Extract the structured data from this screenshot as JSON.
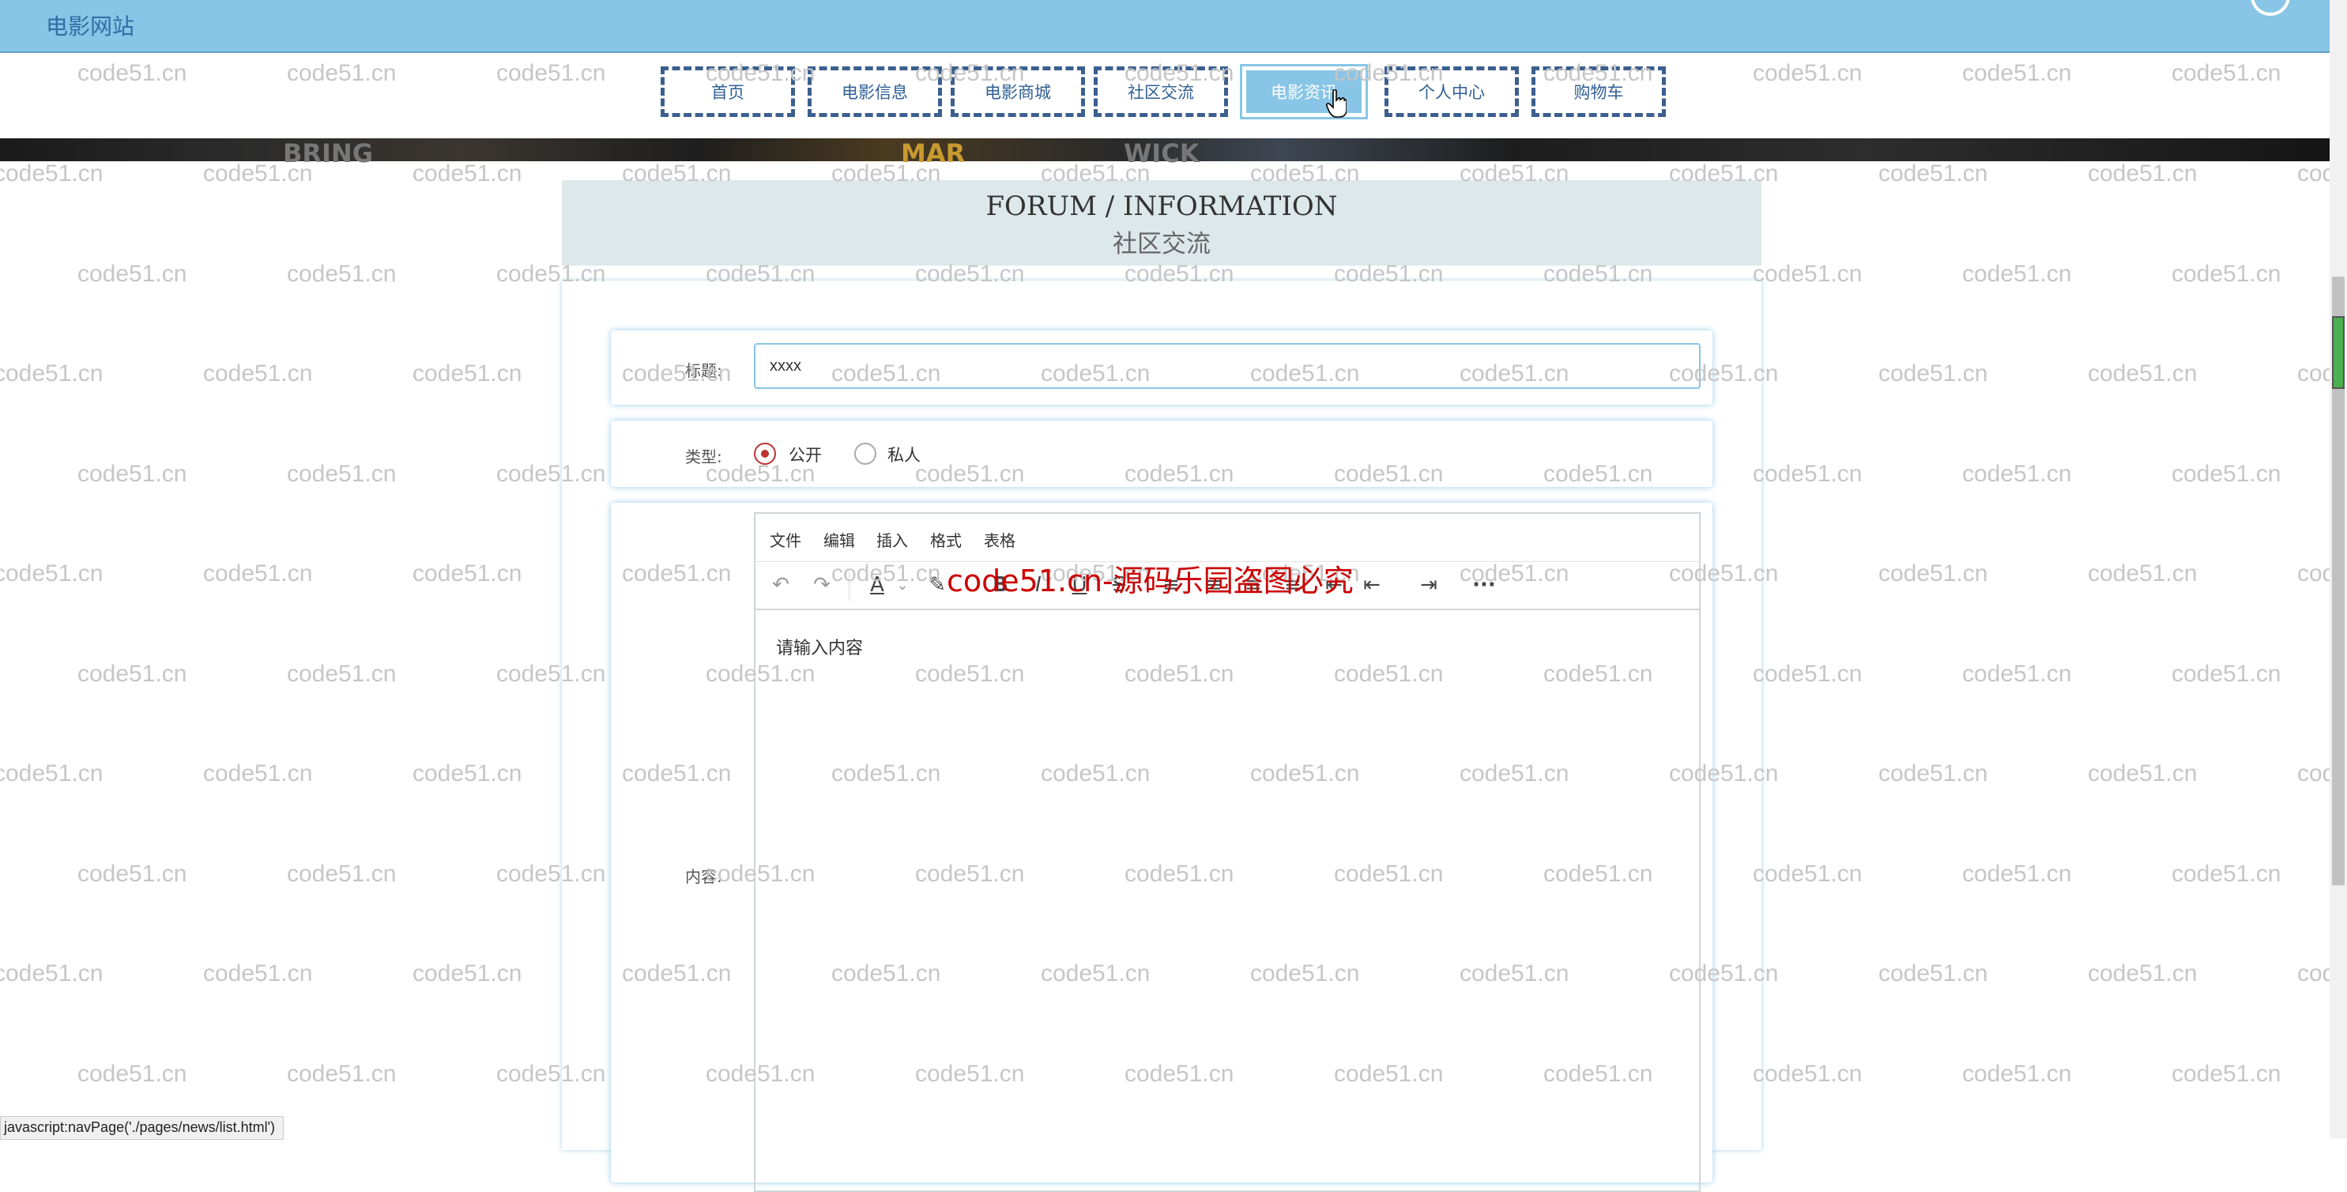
{
  "header": {
    "site_title": "电影网站"
  },
  "nav": {
    "items": [
      {
        "label": "首页"
      },
      {
        "label": "电影信息"
      },
      {
        "label": "电影商城"
      },
      {
        "label": "社区交流"
      },
      {
        "label": "电影资讯"
      },
      {
        "label": "个人中心"
      },
      {
        "label": "购物车"
      }
    ],
    "active_index": 4
  },
  "banner": {
    "fragments": [
      "BRING",
      "MAR",
      "WICK"
    ]
  },
  "section": {
    "title_en": "FORUM / INFORMATION",
    "title_cn": "社区交流"
  },
  "form": {
    "title_label": "标题:",
    "title_value": "xxxx",
    "type_label": "类型:",
    "type_options": [
      {
        "label": "公开",
        "checked": true
      },
      {
        "label": "私人",
        "checked": false
      }
    ],
    "content_label": "内容:"
  },
  "editor": {
    "menu": [
      "文件",
      "编辑",
      "插入",
      "格式",
      "表格"
    ],
    "toolbar_icons": [
      "undo-icon",
      "redo-icon",
      "font-color-icon",
      "dropdown-arrow-icon",
      "highlight-icon",
      "bold-icon",
      "italic-icon",
      "underline-icon",
      "strikethrough-icon",
      "align-left-icon",
      "align-center-icon",
      "align-right-icon",
      "align-justify-icon",
      "outdent-icon",
      "indent-icon",
      "more-icon"
    ],
    "placeholder": "请输入内容"
  },
  "watermark": {
    "text": "code51.cn",
    "notice": "code51.cn-源码乐园盗图必究"
  },
  "status_bar": {
    "url": "javascript:navPage('./pages/news/list.html')"
  },
  "colors": {
    "header_bg": "#88c5e6",
    "nav_border": "#3b5f8e",
    "section_bg": "#dde8ea",
    "radio_checked": "#bb3333",
    "watermark_red": "#cc0000"
  }
}
